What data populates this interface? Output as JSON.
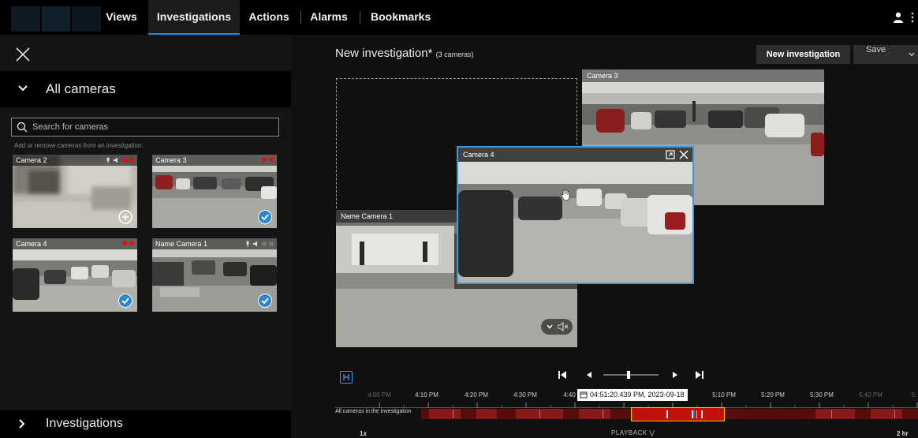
{
  "nav": {
    "items": [
      "Views",
      "Investigations",
      "Actions",
      "Alarms",
      "Bookmarks"
    ],
    "active": "Investigations"
  },
  "sidebar": {
    "section_title": "All cameras",
    "search_placeholder": "Search for cameras",
    "hint": "Add or remove cameras from an investigation.",
    "tiles": [
      {
        "name": "Camera 2",
        "selected": false
      },
      {
        "name": "Camera 3",
        "selected": true
      },
      {
        "name": "Camera 4",
        "selected": true
      },
      {
        "name": "Name Camera 1",
        "selected": true
      }
    ],
    "investigations_title": "Investigations"
  },
  "main": {
    "title": "New investigation*",
    "subtitle": "(3 cameras)",
    "new_button": "New investigation",
    "save_button": "Save",
    "views": [
      {
        "name": "Camera 3"
      },
      {
        "name": "Name Camera 1"
      },
      {
        "name": "Camera 4"
      }
    ]
  },
  "timeline": {
    "ticks": [
      "4:00 PM",
      "4:10 PM",
      "4:20 PM",
      "4:30 PM",
      "4:40",
      "5:10 PM",
      "5:20 PM",
      "5:30 PM",
      "5:40 PM",
      "5:"
    ],
    "timestamp": "04:51:20.439 PM, 2023-09-18",
    "strip_label": "All cameras in the investigation",
    "speed": "1x",
    "mode": "PLAYBACK",
    "span": "2 hr"
  },
  "colors": {
    "accent": "#2f86c9",
    "alert": "#e01010",
    "selection": "#e8c800"
  }
}
